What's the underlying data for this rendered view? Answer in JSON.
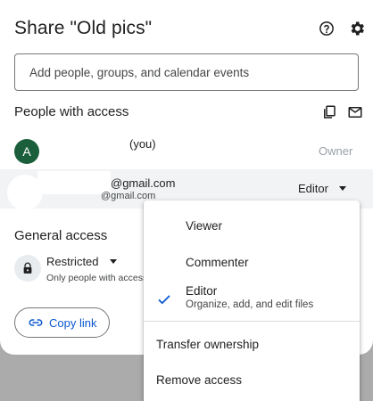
{
  "dialog": {
    "title": "Share \"Old pics\"",
    "help_icon": "help-circle-icon",
    "settings_icon": "gear-icon",
    "add_people_placeholder": "Add people, groups, and calendar events",
    "people_with_access_title": "People with access",
    "copy_icon": "copy-icon",
    "email_icon": "mail-icon"
  },
  "people": [
    {
      "avatar_letter": "A",
      "avatar_color": "#1b5e3b",
      "name": "(you)",
      "role": "Owner"
    },
    {
      "email_primary": "@gmail.com",
      "email_secondary": "@gmail.com",
      "role": "Editor"
    }
  ],
  "general_access": {
    "title": "General access",
    "lock_icon": "lock-icon",
    "setting": "Restricted",
    "description": "Only people with access"
  },
  "copy_link": {
    "label": "Copy link",
    "icon": "link-icon",
    "color": "#0b57d0"
  },
  "role_menu": {
    "items": [
      {
        "label": "Viewer"
      },
      {
        "label": "Commenter"
      },
      {
        "label": "Editor",
        "sublabel": "Organize, add, and edit files",
        "selected": true
      }
    ],
    "actions": [
      {
        "label": "Transfer ownership"
      },
      {
        "label": "Remove access"
      }
    ]
  }
}
